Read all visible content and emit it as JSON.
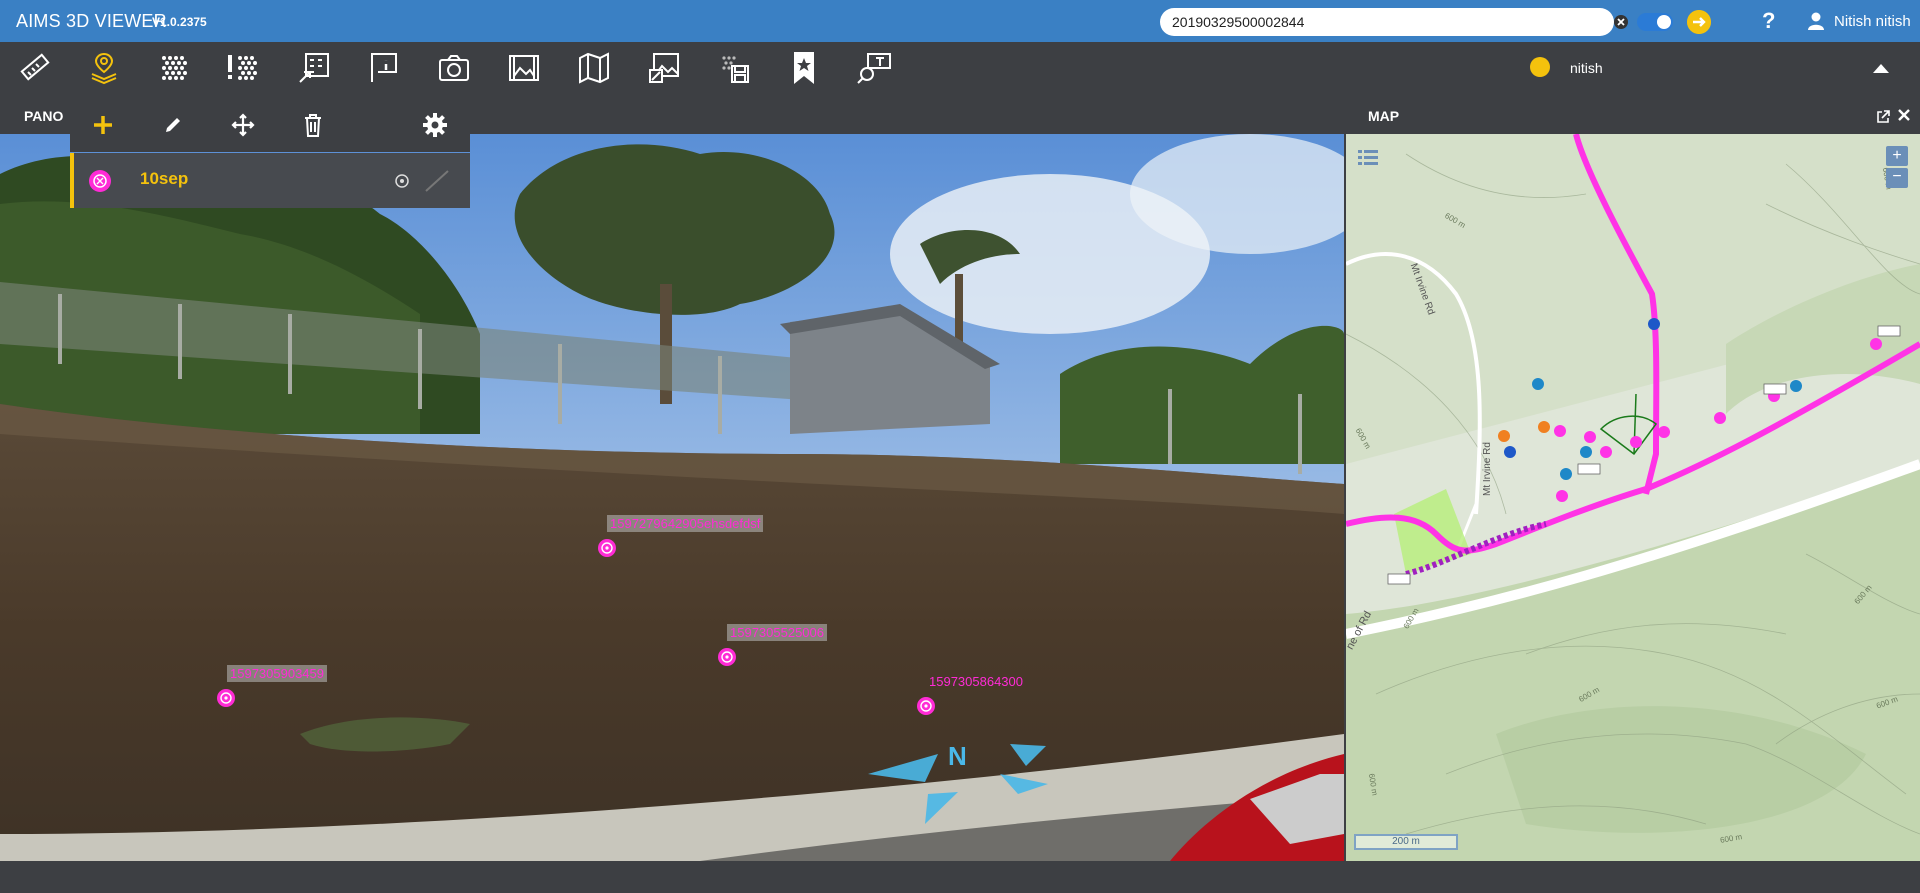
{
  "app": {
    "title": "AIMS 3D VIEWER",
    "version": "V1.0.2375"
  },
  "search": {
    "value": "20190329500002844"
  },
  "user": {
    "name": "Nitish nitish",
    "status_name": "nitish",
    "status_color": "#f4c20d"
  },
  "toolbar": {
    "tools": [
      "ruler-icon",
      "layers-pin-icon",
      "grid-dots-icon",
      "alert-grid-icon",
      "grid-select-icon",
      "info-flag-icon",
      "camera-icon",
      "frame-image-icon",
      "map-icon",
      "image-export-icon",
      "save-grid-icon",
      "bookmark-star-icon",
      "search-sign-icon"
    ],
    "active_tool": "layers-pin-icon"
  },
  "panels": {
    "pano_title": "PANO",
    "map_title": "MAP"
  },
  "layer_panel": {
    "actions": [
      "add-icon",
      "edit-icon",
      "move-icon",
      "delete-icon",
      "settings-icon"
    ],
    "layer_name": "10sep"
  },
  "markers": [
    {
      "label": "1597279642905ehsdefdsf"
    },
    {
      "label": "1597305525006"
    },
    {
      "label": "1597305903459"
    },
    {
      "label": "1597305864300"
    }
  ],
  "compass": {
    "label": "N"
  },
  "map": {
    "roads": [
      "Mt Irvine Rd",
      "Mt Irvine Rd",
      "ne of Rd"
    ],
    "contours": [
      "600 m",
      "600 m",
      "600 m",
      "600 m",
      "600 m",
      "600 m",
      "600 m",
      "600 m",
      "600 m"
    ],
    "scale_label": "200 m",
    "zoom_in": "+",
    "zoom_out": "−"
  },
  "colors": {
    "accent": "#3a80c4",
    "marker": "#ff2bd6",
    "active": "#f4c20d"
  }
}
